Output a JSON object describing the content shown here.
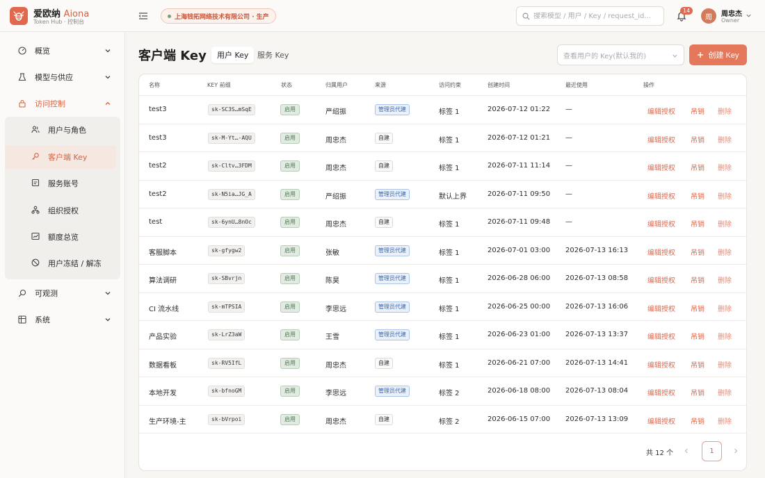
{
  "brand": {
    "name": "爱欧纳",
    "name_en": "Aiona",
    "sub": "Token Hub · 控制台"
  },
  "org": {
    "label": "上海钱拓网络技术有限公司 · 生产"
  },
  "search": {
    "placeholder": "搜索模型 / 用户 / Key / request_id..."
  },
  "notifications": {
    "count": "14"
  },
  "user": {
    "avatar": "周",
    "name": "周忠杰",
    "role": "Owner"
  },
  "sidebar": {
    "items": [
      {
        "label": "概览"
      },
      {
        "label": "模型与供应"
      },
      {
        "label": "访问控制"
      },
      {
        "label": "可观测"
      },
      {
        "label": "系统"
      }
    ],
    "sub_items": [
      {
        "label": "用户与角色"
      },
      {
        "label": "客户端 Key"
      },
      {
        "label": "服务账号"
      },
      {
        "label": "组织授权"
      },
      {
        "label": "额度总览"
      },
      {
        "label": "用户冻结 / 解冻"
      }
    ]
  },
  "page": {
    "title": "客户端 Key",
    "tabs": [
      {
        "label": "用户 Key"
      },
      {
        "label": "服务 Key"
      }
    ],
    "filter_placeholder": "查看用户的 Key(默认我的)",
    "create_label": "创建 Key"
  },
  "table": {
    "headers": [
      "名称",
      "KEY 前缀",
      "状态",
      "归属用户",
      "来源",
      "访问约束",
      "创建时间",
      "最近使用",
      "操作"
    ],
    "actions": {
      "edit": "编辑授权",
      "revoke": "吊销",
      "delete": "删除"
    },
    "rows": [
      {
        "name": "test3",
        "prefix": "sk-SC3S…mSqE",
        "status": "启用",
        "owner": "严绍振",
        "source": "管理员代建",
        "source_type": "admin",
        "constraint": "标签 1",
        "created": "2026-07-12 01:22",
        "last_used": "—"
      },
      {
        "name": "test3",
        "prefix": "sk-M-Yt…-AQU",
        "status": "启用",
        "owner": "周忠杰",
        "source": "自建",
        "source_type": "self",
        "constraint": "标签 1",
        "created": "2026-07-12 01:21",
        "last_used": "—"
      },
      {
        "name": "test2",
        "prefix": "sk-Cltv…3FDM",
        "status": "启用",
        "owner": "周忠杰",
        "source": "自建",
        "source_type": "self",
        "constraint": "标签 1",
        "created": "2026-07-11 11:14",
        "last_used": "—"
      },
      {
        "name": "test2",
        "prefix": "sk-N5ia…JG_A",
        "status": "启用",
        "owner": "严绍振",
        "source": "管理员代建",
        "source_type": "admin",
        "constraint": "默认上界",
        "created": "2026-07-11 09:50",
        "last_used": "—"
      },
      {
        "name": "test",
        "prefix": "sk-6ynU…8nOc",
        "status": "启用",
        "owner": "周忠杰",
        "source": "自建",
        "source_type": "self",
        "constraint": "标签 1",
        "created": "2026-07-11 09:48",
        "last_used": "—"
      },
      {
        "name": "客服脚本",
        "prefix": "sk-gfygw2",
        "status": "启用",
        "owner": "张敏",
        "source": "管理员代建",
        "source_type": "admin",
        "constraint": "标签 1",
        "created": "2026-07-01 03:00",
        "last_used": "2026-07-13 16:13"
      },
      {
        "name": "算法调研",
        "prefix": "sk-SBvrjn",
        "status": "启用",
        "owner": "陈昊",
        "source": "管理员代建",
        "source_type": "admin",
        "constraint": "标签 1",
        "created": "2026-06-28 06:00",
        "last_used": "2026-07-13 08:58"
      },
      {
        "name": "CI 流水线",
        "prefix": "sk-mTPSIA",
        "status": "启用",
        "owner": "李思远",
        "source": "管理员代建",
        "source_type": "admin",
        "constraint": "标签 1",
        "created": "2026-06-25 00:00",
        "last_used": "2026-07-13 16:06"
      },
      {
        "name": "产品实验",
        "prefix": "sk-LrZ3aW",
        "status": "启用",
        "owner": "王雪",
        "source": "管理员代建",
        "source_type": "admin",
        "constraint": "标签 1",
        "created": "2026-06-23 01:00",
        "last_used": "2026-07-13 13:37"
      },
      {
        "name": "数据看板",
        "prefix": "sk-RV5IfL",
        "status": "启用",
        "owner": "周忠杰",
        "source": "自建",
        "source_type": "self",
        "constraint": "标签 1",
        "created": "2026-06-21 07:00",
        "last_used": "2026-07-13 14:41"
      },
      {
        "name": "本地开发",
        "prefix": "sk-bfnoGM",
        "status": "启用",
        "owner": "李思远",
        "source": "管理员代建",
        "source_type": "admin",
        "constraint": "标签 2",
        "created": "2026-06-18 08:00",
        "last_used": "2026-07-13 08:04"
      },
      {
        "name": "生产环境-主",
        "prefix": "sk-bVrpoi",
        "status": "启用",
        "owner": "周忠杰",
        "source": "自建",
        "source_type": "self",
        "constraint": "标签 2",
        "created": "2026-06-15 07:00",
        "last_used": "2026-07-13 13:09"
      }
    ]
  },
  "pagination": {
    "total": "共 12 个",
    "current": "1"
  },
  "colors": {
    "accent": "#e0684c",
    "status_green": "#4d7a55",
    "admin_blue": "#3a67a8"
  }
}
